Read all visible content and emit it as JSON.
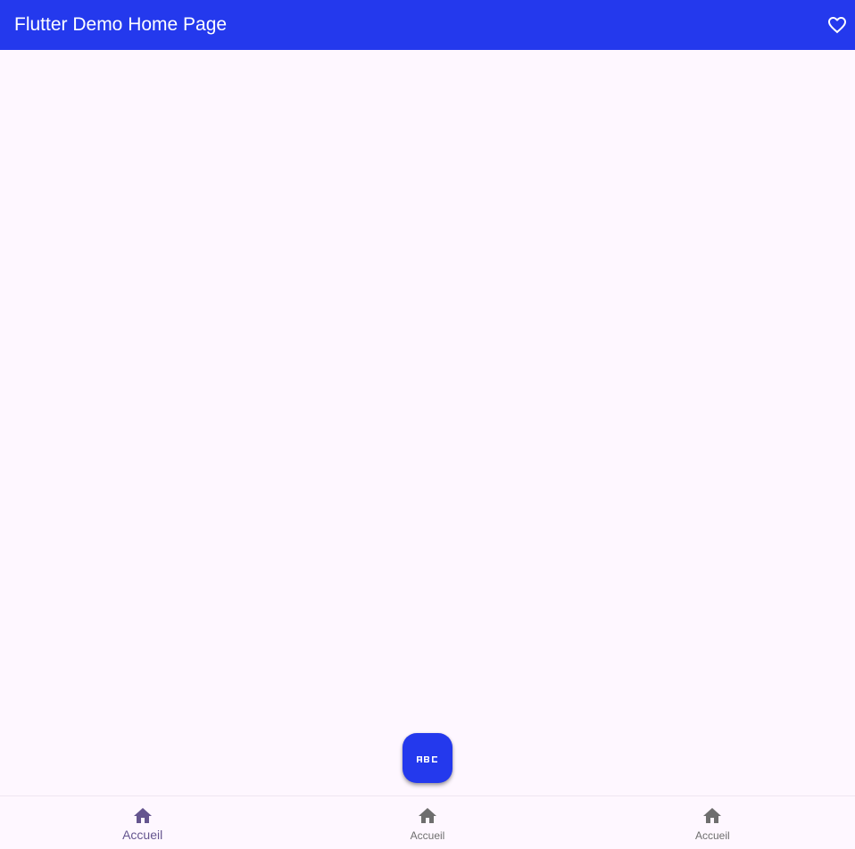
{
  "appbar": {
    "title": "Flutter Demo Home Page",
    "action_icon": "favorite-border-icon"
  },
  "fab": {
    "label": "ABC",
    "icon": "abc-icon"
  },
  "bottom_nav": {
    "items": [
      {
        "label": "Accueil",
        "icon": "home-icon",
        "selected": true
      },
      {
        "label": "Accueil",
        "icon": "home-icon",
        "selected": false
      },
      {
        "label": "Accueil",
        "icon": "home-icon",
        "selected": false
      }
    ]
  },
  "colors": {
    "primary": "#2439ED",
    "background": "#FEF7FF",
    "nav_selected": "#65558F",
    "nav_unselected": "#6E6E6E"
  }
}
